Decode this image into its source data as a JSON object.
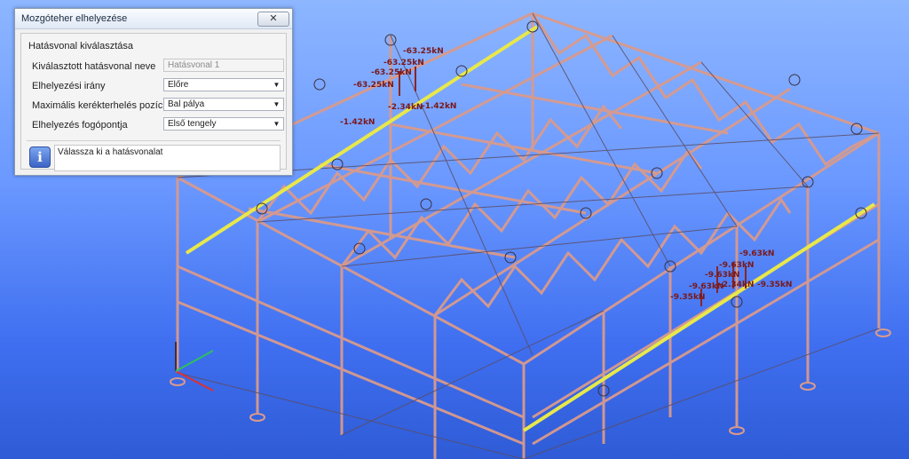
{
  "dialog": {
    "title": "Mozgóteher elhelyezése",
    "close_label": "✕",
    "group_title": "Hatásvonal kiválasztása",
    "rows": [
      {
        "label": "Kiválasztott hatásvonal neve",
        "value": "Hatásvonal 1",
        "kind": "text-disabled"
      },
      {
        "label": "Elhelyezési irány",
        "value": "Előre",
        "kind": "dropdown"
      },
      {
        "label": "Maximális kerékterhelés pozíciója",
        "value": "Bal pálya",
        "kind": "dropdown"
      },
      {
        "label": "Elhelyezés fogópontja",
        "value": "Első tengely",
        "kind": "dropdown"
      }
    ],
    "info_icon": "info-icon",
    "info_text": "Válassza ki a hatásvonalat"
  },
  "loads": {
    "upper_group": [
      "-63.25kN",
      "-63.25kN",
      "-63.25kN",
      "-63.25kN",
      "-2.34kN",
      "-1.42kN",
      "-1.42kN"
    ],
    "lower_group": [
      "-9.63kN",
      "-9.63kN",
      "-9.63kN",
      "-9.63kN",
      "-9.35kN",
      "-2.34kN",
      "-9.35kN"
    ]
  },
  "colors": {
    "frame_member": "#d99a8c",
    "frame_dark": "#5a4d66",
    "crane_rail": "#e8e84a",
    "load_text": "#7a1818",
    "background_top": "#8db6ff",
    "background_bottom": "#2f5bd6"
  },
  "axis_icons": [
    "axis-x-icon",
    "axis-y-icon",
    "axis-z-icon"
  ]
}
